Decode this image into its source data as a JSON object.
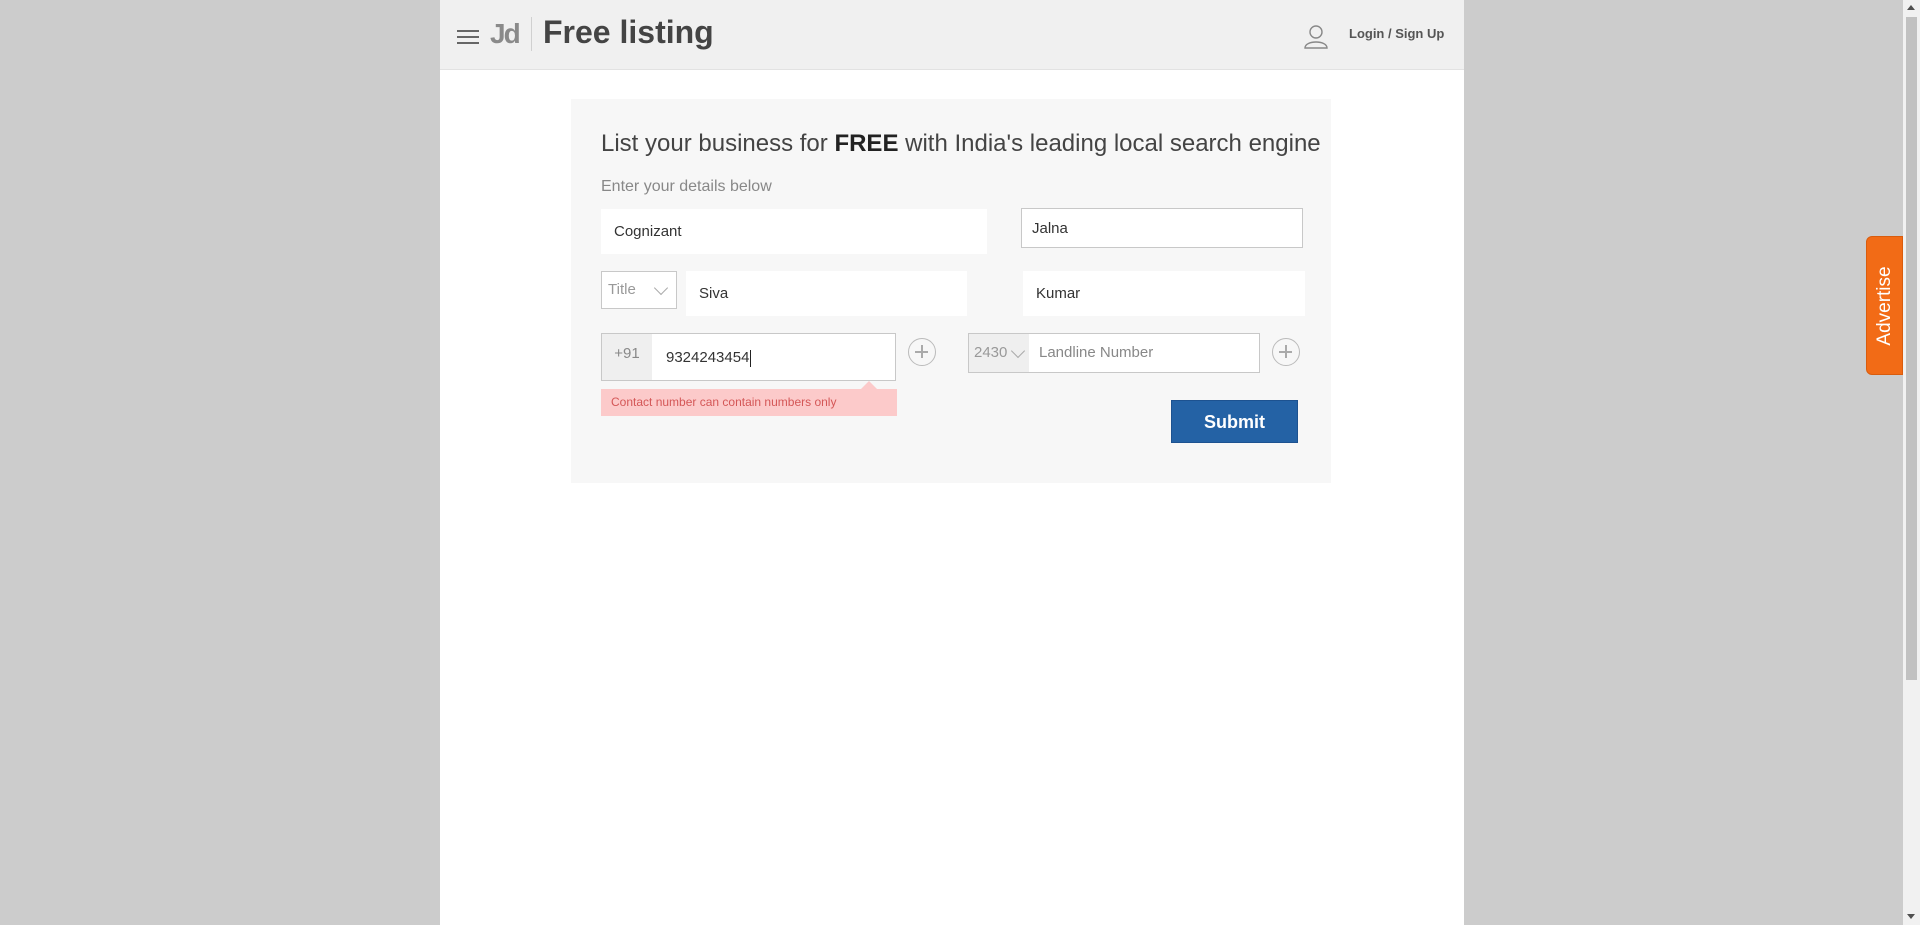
{
  "header": {
    "logo": "Jd",
    "title": "Free listing",
    "login_label": "Login / Sign Up"
  },
  "form": {
    "headline_pre": "List your business for ",
    "headline_bold": "FREE",
    "headline_post": " with India's leading local search engine",
    "subheading": "Enter your details below",
    "company": "Cognizant",
    "city": "Jalna",
    "title_placeholder": "Title",
    "first_name": "Siva",
    "last_name": "Kumar",
    "country_code": "+91",
    "mobile": "9324243454",
    "mobile_error": "Contact number can contain numbers only",
    "std_code": "2430",
    "landline_placeholder": "Landline Number",
    "submit_label": "Submit"
  },
  "advertise_label": "Advertise",
  "colors": {
    "submit": "#2462a5",
    "advertise": "#f26b16",
    "error_bg": "#fccaca",
    "error_text": "#d45757"
  },
  "icons": [
    "menu-icon",
    "user-icon",
    "plus-icon",
    "chevron-down-icon"
  ]
}
